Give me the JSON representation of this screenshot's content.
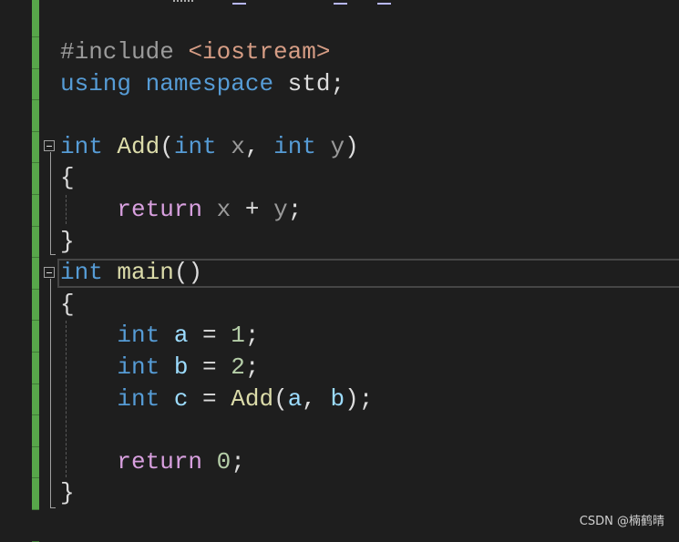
{
  "colors": {
    "background": "#1e1e1e",
    "changed_bar": "#57a64a",
    "keyword": "#569cd6",
    "function": "#dcdcaa",
    "variable": "#9cdcfe",
    "parameter": "#9a9a9a",
    "control": "#d8a0df",
    "number": "#b5cea8",
    "preprocessor": "#9b9b9b",
    "include_path": "#d69d85",
    "plain": "#dcdcdc"
  },
  "code_lines": [
    [
      [
        "#include ",
        "preprocessor"
      ],
      [
        "<iostream>",
        "include_path"
      ]
    ],
    [
      [
        "using",
        "keyword"
      ],
      [
        " ",
        "plain"
      ],
      [
        "namespace",
        "keyword"
      ],
      [
        " std;",
        "plain"
      ]
    ],
    [],
    [
      [
        "int",
        "keyword"
      ],
      [
        " ",
        "plain"
      ],
      [
        "Add",
        "function"
      ],
      [
        "(",
        "plain"
      ],
      [
        "int",
        "keyword"
      ],
      [
        " ",
        "plain"
      ],
      [
        "x",
        "parameter"
      ],
      [
        ", ",
        "plain"
      ],
      [
        "int",
        "keyword"
      ],
      [
        " ",
        "plain"
      ],
      [
        "y",
        "parameter"
      ],
      [
        ")",
        "plain"
      ]
    ],
    [
      [
        "{",
        "plain"
      ]
    ],
    [
      [
        "    ",
        "plain"
      ],
      [
        "return",
        "control"
      ],
      [
        " ",
        "plain"
      ],
      [
        "x",
        "parameter"
      ],
      [
        " + ",
        "plain"
      ],
      [
        "y",
        "parameter"
      ],
      [
        ";",
        "plain"
      ]
    ],
    [
      [
        "}",
        "plain"
      ]
    ],
    [
      [
        "int",
        "keyword"
      ],
      [
        " ",
        "plain"
      ],
      [
        "main",
        "function"
      ],
      [
        "()",
        "plain"
      ]
    ],
    [
      [
        "{",
        "plain"
      ]
    ],
    [
      [
        "    ",
        "plain"
      ],
      [
        "int",
        "keyword"
      ],
      [
        " ",
        "plain"
      ],
      [
        "a",
        "variable"
      ],
      [
        " = ",
        "plain"
      ],
      [
        "1",
        "number"
      ],
      [
        ";",
        "plain"
      ]
    ],
    [
      [
        "    ",
        "plain"
      ],
      [
        "int",
        "keyword"
      ],
      [
        " ",
        "plain"
      ],
      [
        "b",
        "variable"
      ],
      [
        " = ",
        "plain"
      ],
      [
        "2",
        "number"
      ],
      [
        ";",
        "plain"
      ]
    ],
    [
      [
        "    ",
        "plain"
      ],
      [
        "int",
        "keyword"
      ],
      [
        " ",
        "plain"
      ],
      [
        "c",
        "variable"
      ],
      [
        " = ",
        "plain"
      ],
      [
        "Add",
        "function"
      ],
      [
        "(",
        "plain"
      ],
      [
        "a",
        "variable"
      ],
      [
        ", ",
        "plain"
      ],
      [
        "b",
        "variable"
      ],
      [
        ");",
        "plain"
      ]
    ],
    [],
    [
      [
        "    ",
        "plain"
      ],
      [
        "return",
        "control"
      ],
      [
        " ",
        "plain"
      ],
      [
        "0",
        "number"
      ],
      [
        ";",
        "plain"
      ]
    ],
    [
      [
        "}",
        "plain"
      ]
    ]
  ],
  "watermark": "CSDN @楠鹤晴"
}
